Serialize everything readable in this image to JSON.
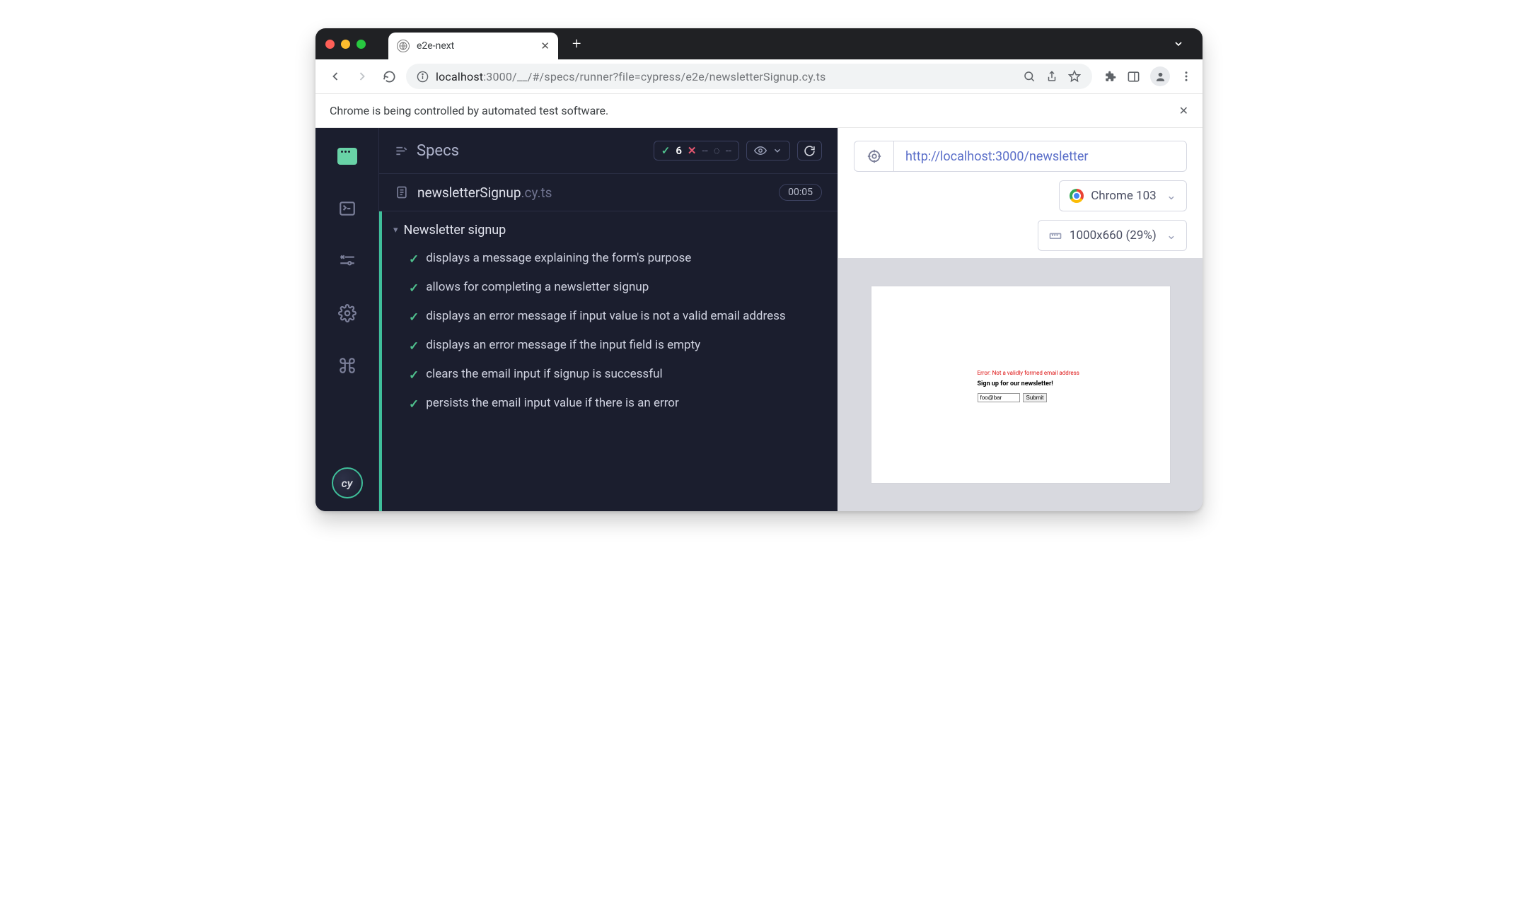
{
  "browser": {
    "tab_title": "e2e-next",
    "url_host": "localhost",
    "url_rest": ":3000/__/#/specs/runner?file=cypress/e2e/newsletterSignup.cy.ts"
  },
  "banner": {
    "text": "Chrome is being controlled by automated test software."
  },
  "reporter": {
    "title": "Specs",
    "stats": {
      "passed": "6",
      "failed": "--",
      "pending": "--"
    },
    "file_name": "newsletterSignup",
    "file_ext": ".cy.ts",
    "duration": "00:05",
    "suite": "Newsletter signup",
    "tests": [
      "displays a message explaining the form's purpose",
      "allows for completing a newsletter signup",
      "displays an error message if input value is not a valid email address",
      "displays an error message if the input field is empty",
      "clears the email input if signup is successful",
      "persists the email input value if there is an error"
    ]
  },
  "aut": {
    "url": "http://localhost:3000/newsletter",
    "browser_label": "Chrome 103",
    "viewport_label": "1000x660 (29%)",
    "preview": {
      "error": "Error: Not a validly formed email address",
      "heading": "Sign up for our newsletter!",
      "input_value": "foo@bar",
      "submit": "Submit"
    }
  }
}
